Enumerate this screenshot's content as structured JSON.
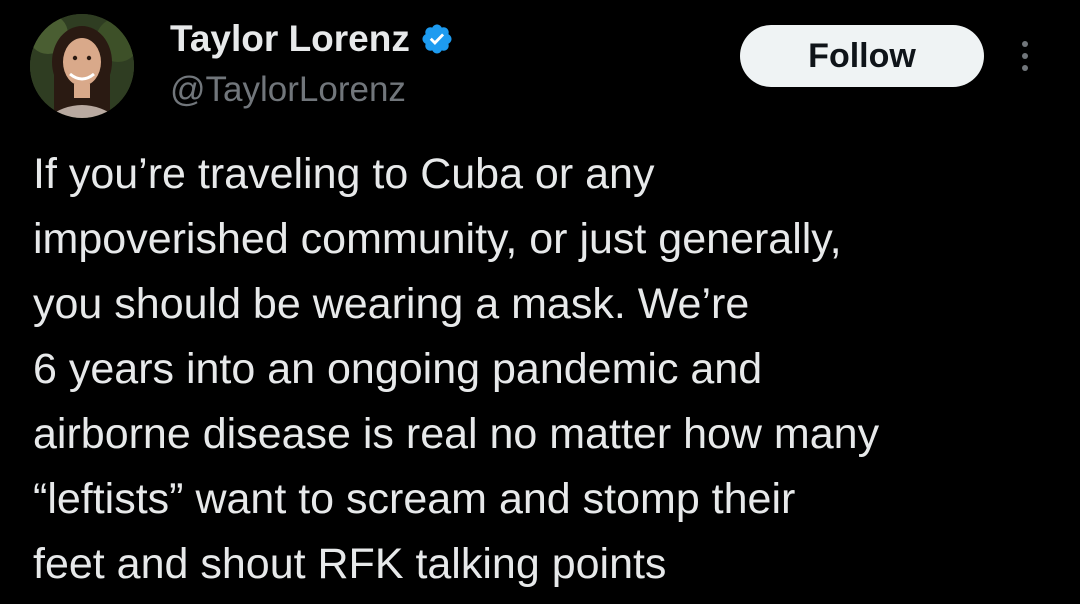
{
  "author": {
    "display_name": "Taylor Lorenz",
    "handle": "@TaylorLorenz",
    "verified": true
  },
  "actions": {
    "follow_label": "Follow"
  },
  "icons": {
    "verified": "verified-badge-icon",
    "more": "more-options-icon"
  },
  "tweet": {
    "lines": [
      "If you’re traveling to Cuba or any",
      "impoverished community, or just generally,",
      "you should be wearing a mask. We’re",
      "6 years into an ongoing pandemic and",
      "airborne disease is real no matter how many",
      "“leftists” want to scream and stomp their",
      "feet and shout RFK talking points"
    ]
  },
  "colors": {
    "background": "#000000",
    "text_primary": "#e7e9ea",
    "text_secondary": "#71767b",
    "verified_blue": "#1d9bf0",
    "button_bg": "#eff3f4",
    "button_text": "#0f1419"
  }
}
